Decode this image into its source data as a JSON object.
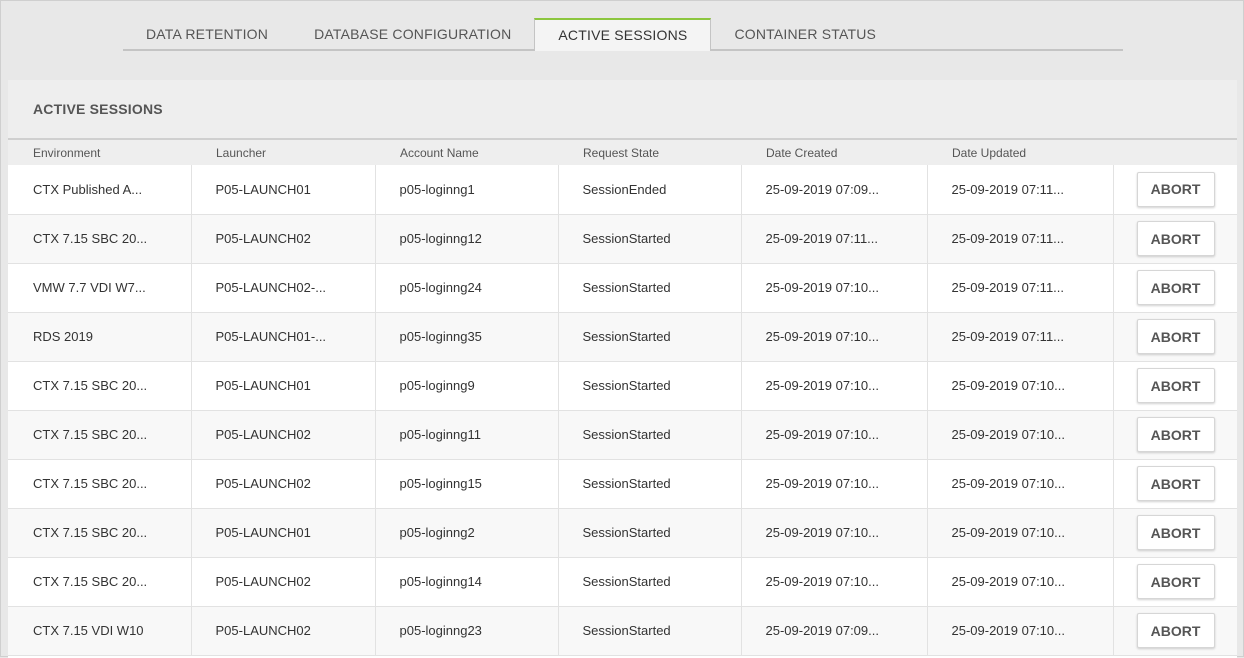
{
  "tabs": [
    {
      "label": "DATA RETENTION",
      "active": false
    },
    {
      "label": "DATABASE CONFIGURATION",
      "active": false
    },
    {
      "label": "ACTIVE SESSIONS",
      "active": true
    },
    {
      "label": "CONTAINER STATUS",
      "active": false
    }
  ],
  "panel": {
    "title": "ACTIVE SESSIONS"
  },
  "table": {
    "columns": [
      "Environment",
      "Launcher",
      "Account Name",
      "Request State",
      "Date Created",
      "Date Updated"
    ],
    "action_label": "ABORT",
    "rows": [
      {
        "environment": "CTX Published A...",
        "launcher": "P05-LAUNCH01",
        "account": "p05-loginng1",
        "state": "SessionEnded",
        "created": "25-09-2019 07:09...",
        "updated": "25-09-2019 07:11..."
      },
      {
        "environment": "CTX 7.15 SBC 20...",
        "launcher": "P05-LAUNCH02",
        "account": "p05-loginng12",
        "state": "SessionStarted",
        "created": "25-09-2019 07:11...",
        "updated": "25-09-2019 07:11..."
      },
      {
        "environment": "VMW 7.7 VDI W7...",
        "launcher": "P05-LAUNCH02-...",
        "account": "p05-loginng24",
        "state": "SessionStarted",
        "created": "25-09-2019 07:10...",
        "updated": "25-09-2019 07:11..."
      },
      {
        "environment": "RDS 2019",
        "launcher": "P05-LAUNCH01-...",
        "account": "p05-loginng35",
        "state": "SessionStarted",
        "created": "25-09-2019 07:10...",
        "updated": "25-09-2019 07:11..."
      },
      {
        "environment": "CTX 7.15 SBC 20...",
        "launcher": "P05-LAUNCH01",
        "account": "p05-loginng9",
        "state": "SessionStarted",
        "created": "25-09-2019 07:10...",
        "updated": "25-09-2019 07:10..."
      },
      {
        "environment": "CTX 7.15 SBC 20...",
        "launcher": "P05-LAUNCH02",
        "account": "p05-loginng11",
        "state": "SessionStarted",
        "created": "25-09-2019 07:10...",
        "updated": "25-09-2019 07:10..."
      },
      {
        "environment": "CTX 7.15 SBC 20...",
        "launcher": "P05-LAUNCH02",
        "account": "p05-loginng15",
        "state": "SessionStarted",
        "created": "25-09-2019 07:10...",
        "updated": "25-09-2019 07:10..."
      },
      {
        "environment": "CTX 7.15 SBC 20...",
        "launcher": "P05-LAUNCH01",
        "account": "p05-loginng2",
        "state": "SessionStarted",
        "created": "25-09-2019 07:10...",
        "updated": "25-09-2019 07:10..."
      },
      {
        "environment": "CTX 7.15 SBC 20...",
        "launcher": "P05-LAUNCH02",
        "account": "p05-loginng14",
        "state": "SessionStarted",
        "created": "25-09-2019 07:10...",
        "updated": "25-09-2019 07:10..."
      },
      {
        "environment": "CTX 7.15 VDI W10",
        "launcher": "P05-LAUNCH02",
        "account": "p05-loginng23",
        "state": "SessionStarted",
        "created": "25-09-2019 07:09...",
        "updated": "25-09-2019 07:10..."
      }
    ]
  },
  "colors": {
    "accent": "#8cc63f",
    "page_bg": "#e8e8e8",
    "header_bg": "#eeeeee"
  }
}
